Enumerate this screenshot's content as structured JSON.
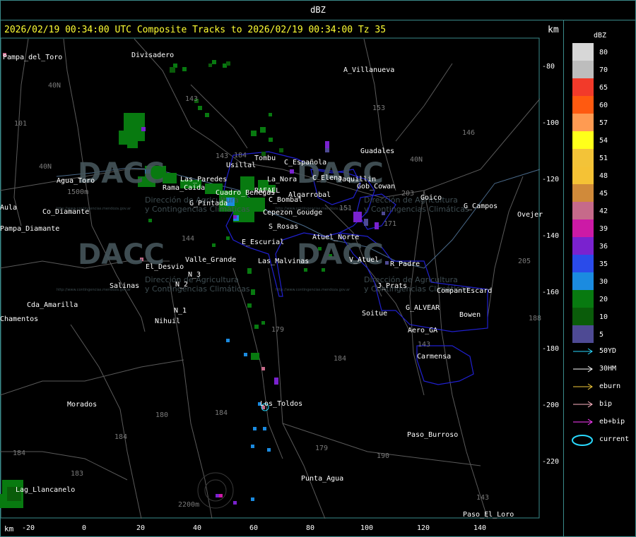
{
  "title_bar": {
    "label": "dBZ"
  },
  "header": {
    "text": "2026/02/19 00:34:00 UTC Composite Tracks to 2026/02/19 00:34:00 Tz 35",
    "unit_right": "km",
    "unit_bottom": "km"
  },
  "axes": {
    "x_ticks": [
      "-20",
      "0",
      "20",
      "40",
      "60",
      "80",
      "100",
      "120",
      "140"
    ],
    "y_ticks": [
      "-80",
      "-100",
      "-120",
      "-140",
      "-160",
      "-180",
      "-200",
      "-220"
    ]
  },
  "legend": {
    "title": "dBZ",
    "colors": [
      {
        "value": "80",
        "color": "#d7d7d7"
      },
      {
        "value": "70",
        "color": "#bdbdbd"
      },
      {
        "value": "65",
        "color": "#f23a2a"
      },
      {
        "value": "60",
        "color": "#ff5a10"
      },
      {
        "value": "57",
        "color": "#ff9b52"
      },
      {
        "value": "54",
        "color": "#ffff1a"
      },
      {
        "value": "51",
        "color": "#f3c338"
      },
      {
        "value": "48",
        "color": "#f5c235"
      },
      {
        "value": "45",
        "color": "#d08a3a"
      },
      {
        "value": "42",
        "color": "#c66a8a"
      },
      {
        "value": "39",
        "color": "#cc1aa6"
      },
      {
        "value": "36",
        "color": "#7a22cf"
      },
      {
        "value": "35",
        "color": "#2a4bea"
      },
      {
        "value": "30",
        "color": "#1b8be0"
      },
      {
        "value": "20",
        "color": "#087a10"
      },
      {
        "value": "10",
        "color": "#0a5c0a"
      },
      {
        "value": "5",
        "color": "#4e4a94"
      }
    ],
    "tracks": [
      {
        "label": "50YD",
        "color": "#29d9ff"
      },
      {
        "label": "30HM",
        "color": "#ffffff"
      },
      {
        "label": "eburn",
        "color": "#f2c83a"
      },
      {
        "label": "bip",
        "color": "#ffb5c4"
      },
      {
        "label": "eb+bip",
        "color": "#ff3cff"
      },
      {
        "label": "current",
        "color": "#29d9ff"
      }
    ]
  },
  "places": [
    {
      "name": "Divisadero"
    },
    {
      "name": "A_Villanueva"
    },
    {
      "name": "Guadales"
    },
    {
      "name": "Usillal"
    },
    {
      "name": "Tombu"
    },
    {
      "name": "C_Española"
    },
    {
      "name": "La_Nora"
    },
    {
      "name": "C_Elena"
    },
    {
      "name": "Jaquillin"
    },
    {
      "name": "Gob_Cowan"
    },
    {
      "name": "Goico"
    },
    {
      "name": "G_Campos"
    },
    {
      "name": "Ovejer"
    },
    {
      "name": "Agua_Toro"
    },
    {
      "name": "Co_Diamante"
    },
    {
      "name": "Rama_Caida"
    },
    {
      "name": "G_Pintada"
    },
    {
      "name": "Las_Paredes"
    },
    {
      "name": "Algarrobal"
    },
    {
      "name": "C_Bombal"
    },
    {
      "name": "Cuadro_Benegas"
    },
    {
      "name": "RAFAEL"
    },
    {
      "name": "Pampa_Diamante"
    },
    {
      "name": "Pampa_del_Toro"
    },
    {
      "name": "Cepezon_Goudge"
    },
    {
      "name": "S_Rosas"
    },
    {
      "name": "Atuel_Norte"
    },
    {
      "name": "E_Escurial"
    },
    {
      "name": "Valle_Grande"
    },
    {
      "name": "El_Desvio"
    },
    {
      "name": "Las_Malvinas"
    },
    {
      "name": "V_Atuel"
    },
    {
      "name": "R_Padre"
    },
    {
      "name": "J_Prats"
    },
    {
      "name": "CompantEscard"
    },
    {
      "name": "G_ALVEAR"
    },
    {
      "name": "Bowen"
    },
    {
      "name": "Soitue"
    },
    {
      "name": "Aero_GA"
    },
    {
      "name": "Carmensa"
    },
    {
      "name": "Salinas"
    },
    {
      "name": "N_2"
    },
    {
      "name": "N_3"
    },
    {
      "name": "N_1"
    },
    {
      "name": "Nihuil"
    },
    {
      "name": "Cda_Amarilla"
    },
    {
      "name": "Chamentos"
    },
    {
      "name": "Morados"
    },
    {
      "name": "Los_Toldos"
    },
    {
      "name": "Paso_Burroso"
    },
    {
      "name": "Punta_Agua"
    },
    {
      "name": "Lag_Llancanelo"
    },
    {
      "name": "Paso_El_Loro"
    },
    {
      "name": "Aula"
    }
  ],
  "roads": [
    {
      "name": "143"
    },
    {
      "name": "153"
    },
    {
      "name": "146"
    },
    {
      "name": "101"
    },
    {
      "name": "40N"
    },
    {
      "name": "40N"
    },
    {
      "name": "1500m"
    },
    {
      "name": "144"
    },
    {
      "name": "143"
    },
    {
      "name": "171"
    },
    {
      "name": "203"
    },
    {
      "name": "205"
    },
    {
      "name": "179"
    },
    {
      "name": "184"
    },
    {
      "name": "180"
    },
    {
      "name": "184"
    },
    {
      "name": "184"
    },
    {
      "name": "183"
    },
    {
      "name": "179"
    },
    {
      "name": "190"
    },
    {
      "name": "143"
    },
    {
      "name": "184"
    },
    {
      "name": "2200m"
    },
    {
      "name": "188"
    },
    {
      "name": "184"
    },
    {
      "name": "143"
    },
    {
      "name": "40N"
    },
    {
      "name": "151"
    }
  ],
  "watermark": {
    "name": "DACC",
    "line1": "Dirección de Agricultura",
    "line2": "y Contingencias Climáticas",
    "url": "http://www.contingencias.mendoza.gov.ar"
  }
}
